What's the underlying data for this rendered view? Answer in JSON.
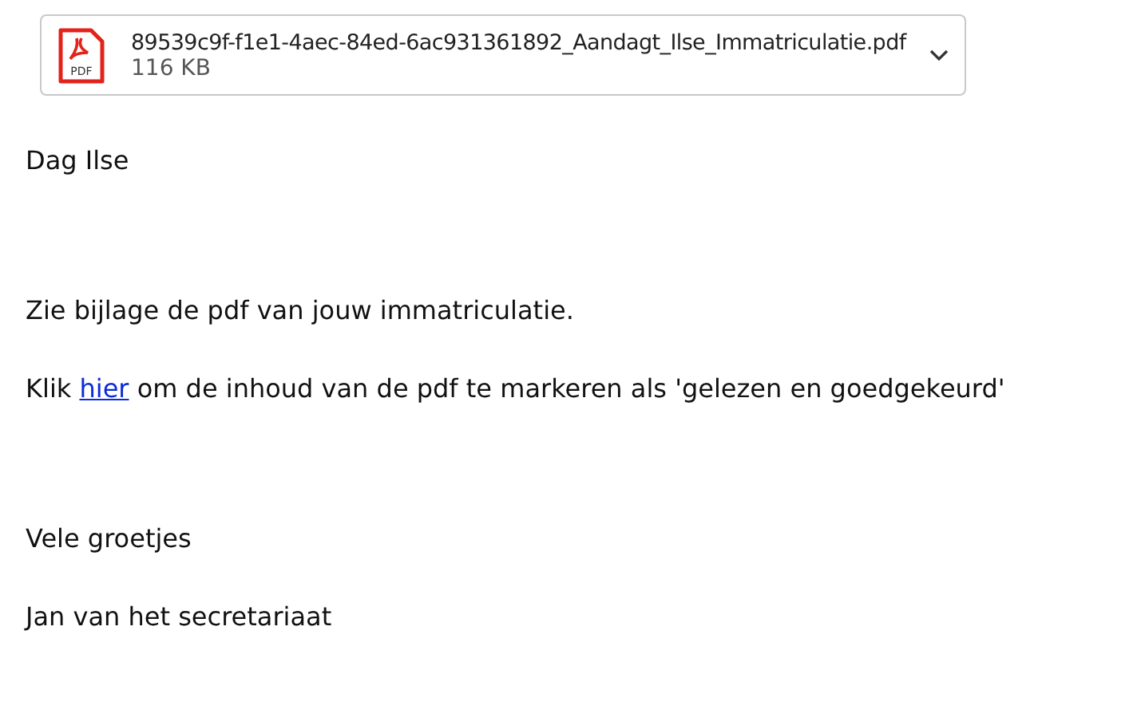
{
  "attachment": {
    "icon_label": "PDF",
    "filename": "89539c9f-f1e1-4aec-84ed-6ac931361892_Aandagt_Ilse_Immatriculatie.pdf",
    "size": "116 KB"
  },
  "body": [
    {
      "text": "Dag Ilse"
    },
    {
      "text": "Zie bijlage de pdf van jouw immatriculatie."
    },
    {
      "text": "Klik ",
      "link": "hier",
      "after": " om de inhoud van de pdf te markeren als 'gelezen en goedgekeurd'"
    },
    {
      "text": "Vele groetjes"
    },
    {
      "text": "Jan van het secretariaat"
    }
  ]
}
